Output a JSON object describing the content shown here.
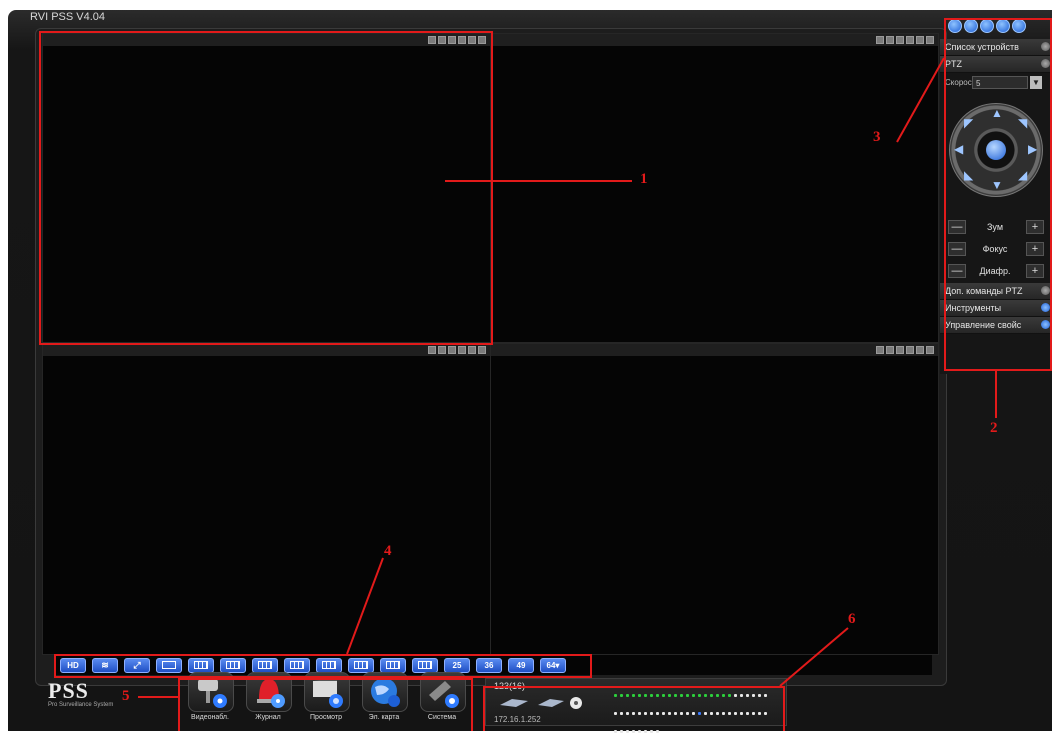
{
  "app": {
    "title": "RVI PSS  V4.04"
  },
  "right_panel": {
    "device_list_label": "Список устройств",
    "ptz_label": "PTZ",
    "speed_label": "Скорость",
    "speed_value": "5",
    "zoom_label": "Зум",
    "focus_label": "Фокус",
    "iris_label": "Диафр.",
    "minus": "—",
    "plus": "+",
    "extra_ptz_label": "Доп. команды PTZ",
    "tools_label": "Инструменты",
    "props_label": "Управление свойс"
  },
  "layout_toolbar": {
    "buttons": [
      "HD",
      "",
      "",
      "",
      "",
      "",
      "",
      "",
      "",
      "",
      "",
      "",
      "25",
      "36",
      "49",
      "64▾"
    ]
  },
  "logo": {
    "main": "PSS",
    "sub": "Pro Surveillance System"
  },
  "dock": {
    "items": [
      {
        "label": "Видеонабл.",
        "icon": "camera-icon"
      },
      {
        "label": "Журнал",
        "icon": "alarm-icon"
      },
      {
        "label": "Просмотр",
        "icon": "playback-icon"
      },
      {
        "label": "Эл. карта",
        "icon": "emap-icon"
      },
      {
        "label": "Система",
        "icon": "settings-icon"
      }
    ]
  },
  "status": {
    "code": "123(16)",
    "ip": "172.16.1.252"
  },
  "annotations": {
    "a1": "1",
    "a2": "2",
    "a3": "3",
    "a4": "4",
    "a5": "5",
    "a6": "6"
  },
  "colors": {
    "accent": "#1f4fc4",
    "annotation": "#e21a1a",
    "led_green": "#2ccf3c"
  }
}
